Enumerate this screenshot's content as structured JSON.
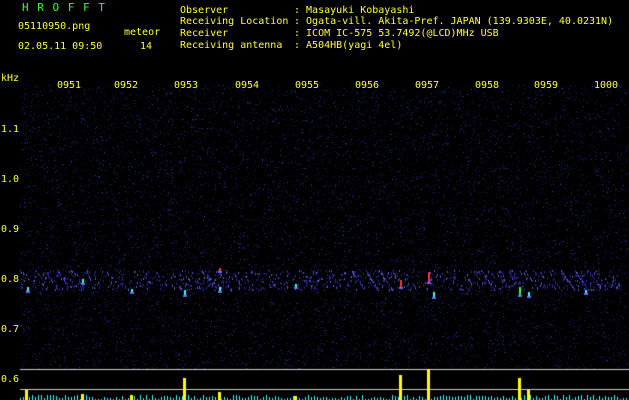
{
  "header": {
    "station": "H R O F F T",
    "filename": "05110950.png",
    "datetime": "02.05.11 09:50",
    "meteor_label": "meteor",
    "meteor_count": "14",
    "info": [
      {
        "label": "Observer",
        "value": ": Masayuki Kobayashi"
      },
      {
        "label": "Receiving Location",
        "value": ": Ogata-vill. Akita-Pref. JAPAN (139.9303E, 40.0231N)"
      },
      {
        "label": "Receiver",
        "value": ": ICOM IC-575 53.7492(@LCD)MHz USB"
      },
      {
        "label": "Receiving antenna",
        "value": ": A504HB(yagi 4el)"
      }
    ]
  },
  "axis": {
    "y_unit": "kHz",
    "y_ticks": [
      "1.1",
      "1.0",
      "0.9",
      "0.8",
      "0.7",
      "0.6"
    ],
    "x_ticks": [
      "0951",
      "0952",
      "0953",
      "0954",
      "0955",
      "0956",
      "0957",
      "0958",
      "0959",
      "1000"
    ]
  },
  "colors": {
    "text": "#ffff33",
    "station": "#33ff33",
    "background": "#000000",
    "noise": "#1a1a6e",
    "signal_red": "#ff3333",
    "signal_green": "#33ff33",
    "signal_cyan": "#33ffff",
    "power_trace": "#ffff00"
  }
}
